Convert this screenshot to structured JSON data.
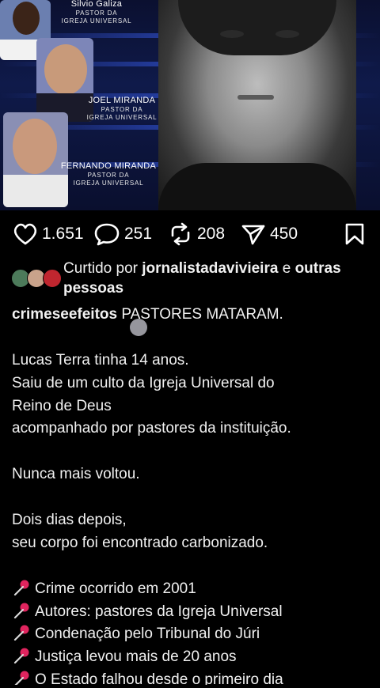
{
  "post_image": {
    "people": [
      {
        "name": "Silvio Galiza",
        "role_line1": "PASTOR DA",
        "role_line2": "IGREJA UNIVERSAL"
      },
      {
        "name": "JOEL MIRANDA",
        "role_line1": "PASTOR DA",
        "role_line2": "IGREJA UNIVERSAL"
      },
      {
        "name": "FERNANDO MIRANDA",
        "role_line1": "PASTOR DA",
        "role_line2": "IGREJA UNIVERSAL"
      }
    ]
  },
  "actions": {
    "likes": "1.651",
    "comments": "251",
    "reposts": "208",
    "shares": "450",
    "icons": [
      "heart-icon",
      "comment-icon",
      "repost-icon",
      "send-icon",
      "bookmark-icon"
    ]
  },
  "liked_by": {
    "prefix": "Curtido por",
    "user": "jornalistadavivieira",
    "conjunction": "e",
    "others": "outras pessoas"
  },
  "caption": {
    "handle": "crimeseefeitos",
    "headline": "PASTORES MATARAM.",
    "p1_l1": "Lucas Terra tinha 14 anos.",
    "p1_l2": "Saiu de um culto da Igreja Universal do",
    "p1_l3": "Reino de Deus",
    "p1_l4": "acompanhado por pastores da instituição.",
    "p2": "Nunca mais voltou.",
    "p3_l1": "Dois dias depois,",
    "p3_l2": "seu corpo foi encontrado carbonizado.",
    "bullets": [
      "Crime ocorrido em 2001",
      "Autores: pastores da Igreja Universal",
      "Condenação pelo Tribunal do Júri",
      "Justiça levou mais de 20 anos",
      "O Estado falhou desde o primeiro dia"
    ]
  },
  "colors": {
    "background": "#000000",
    "text": "#f1f1f1",
    "pin": "#e0245e"
  }
}
